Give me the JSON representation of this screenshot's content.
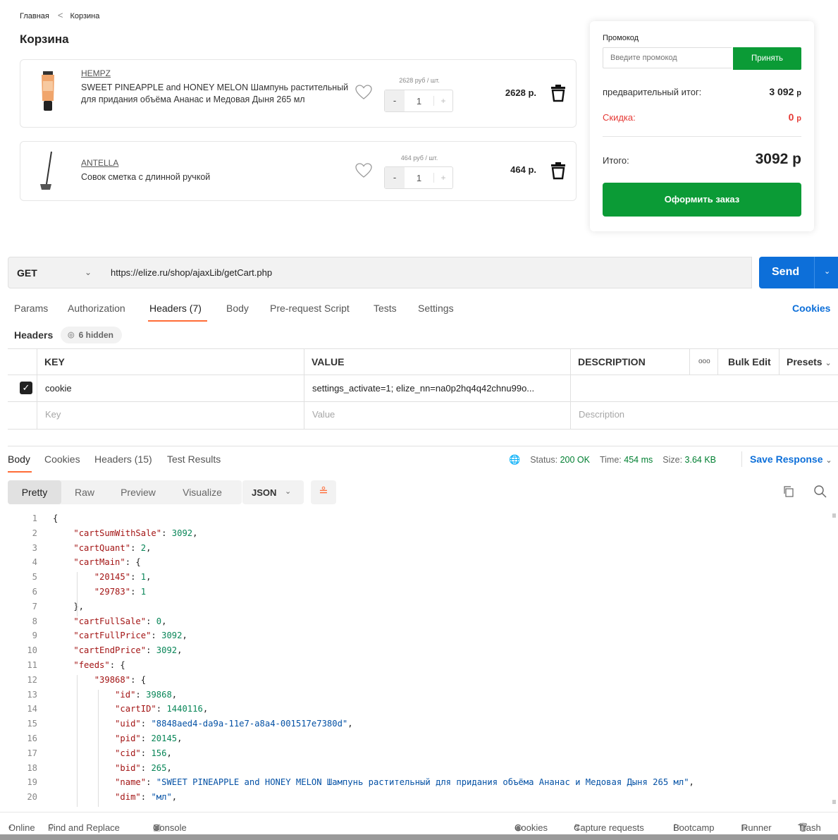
{
  "shop": {
    "breadcrumb": {
      "home": "Главная",
      "current": "Корзина"
    },
    "title": "Корзина",
    "items": [
      {
        "brand": "HEMPZ",
        "name": "SWEET PINEAPPLE and HONEY MELON Шампунь растительный для придания объёма Ананас и Медовая Дыня 265 мл",
        "unit_price": "2628 руб / шт.",
        "qty": "1",
        "total": "2628 р."
      },
      {
        "brand": "ANTELLA",
        "name": "Совок сметка с длинной ручкой",
        "unit_price": "464 руб / шт.",
        "qty": "1",
        "total": "464 р."
      }
    ],
    "stepper": {
      "minus": "-",
      "plus": "+"
    },
    "summary": {
      "promo_label": "Промокод",
      "promo_placeholder": "Введите промокод",
      "apply": "Принять",
      "subtotal_label": "предварительный итог:",
      "subtotal_value": "3 092",
      "discount_label": "Скидка:",
      "discount_value": "0",
      "currency": "р",
      "total_label": "Итого:",
      "total_value": "3092 р",
      "checkout": "Оформить заказ"
    },
    "accent_color": "#0b9b36"
  },
  "request": {
    "method": "GET",
    "url": "https://elize.ru/shop/ajaxLib/getCart.php",
    "send": "Send",
    "tabs": [
      "Params",
      "Authorization",
      "Headers (7)",
      "Body",
      "Pre-request Script",
      "Tests",
      "Settings"
    ],
    "active_tab": "Headers (7)",
    "cookies_link": "Cookies",
    "headers_label": "Headers",
    "hidden_label": "6 hidden",
    "table": {
      "columns": [
        "KEY",
        "VALUE",
        "DESCRIPTION"
      ],
      "more": "ooo",
      "bulk_edit": "Bulk Edit",
      "presets": "Presets",
      "rows": [
        {
          "key": "cookie",
          "value": "settings_activate=1; elize_nn=na0p2hq4q42chnu99o...",
          "description": ""
        }
      ],
      "placeholder": {
        "key": "Key",
        "value": "Value",
        "description": "Description"
      }
    }
  },
  "response": {
    "tabs": [
      "Body",
      "Cookies",
      "Headers (15)",
      "Test Results"
    ],
    "status_label": "Status:",
    "status_value": "200 OK",
    "time_label": "Time:",
    "time_value": "454 ms",
    "size_label": "Size:",
    "size_value": "3.64 KB",
    "save": "Save Response",
    "view_tabs": [
      "Pretty",
      "Raw",
      "Preview",
      "Visualize"
    ],
    "format": "JSON",
    "code_lines": [
      {
        "n": "1",
        "t": "{"
      },
      {
        "n": "2",
        "t": "    \"cartSumWithSale\": 3092,"
      },
      {
        "n": "3",
        "t": "    \"cartQuant\": 2,"
      },
      {
        "n": "4",
        "t": "    \"cartMain\": {"
      },
      {
        "n": "5",
        "t": "        \"20145\": 1,"
      },
      {
        "n": "6",
        "t": "        \"29783\": 1"
      },
      {
        "n": "7",
        "t": "    },"
      },
      {
        "n": "8",
        "t": "    \"cartFullSale\": 0,"
      },
      {
        "n": "9",
        "t": "    \"cartFullPrice\": 3092,"
      },
      {
        "n": "10",
        "t": "    \"cartEndPrice\": 3092,"
      },
      {
        "n": "11",
        "t": "    \"feeds\": {"
      },
      {
        "n": "12",
        "t": "        \"39868\": {"
      },
      {
        "n": "13",
        "t": "            \"id\": 39868,"
      },
      {
        "n": "14",
        "t": "            \"cartID\": 1440116,"
      },
      {
        "n": "15",
        "t": "            \"uid\": \"8848aed4-da9a-11e7-a8a4-001517e7380d\","
      },
      {
        "n": "16",
        "t": "            \"pid\": 20145,"
      },
      {
        "n": "17",
        "t": "            \"cid\": 156,"
      },
      {
        "n": "18",
        "t": "            \"bid\": 265,"
      },
      {
        "n": "19",
        "t": "            \"name\": \"SWEET PINEAPPLE and HONEY MELON Шампунь растительный для придания объёма Ананас и Медовая Дыня 265 мл\","
      },
      {
        "n": "20",
        "t": "            \"dim\": \"мл\","
      }
    ]
  },
  "footer": {
    "left": [
      "Online",
      "Find and Replace",
      "Console"
    ],
    "right": [
      "Cookies",
      "Capture requests",
      "Bootcamp",
      "Runner",
      "Trash"
    ]
  },
  "colors": {
    "postman_accent": "#ff6c37",
    "postman_blue": "#0d6fd9",
    "status_green": "#007f31"
  }
}
